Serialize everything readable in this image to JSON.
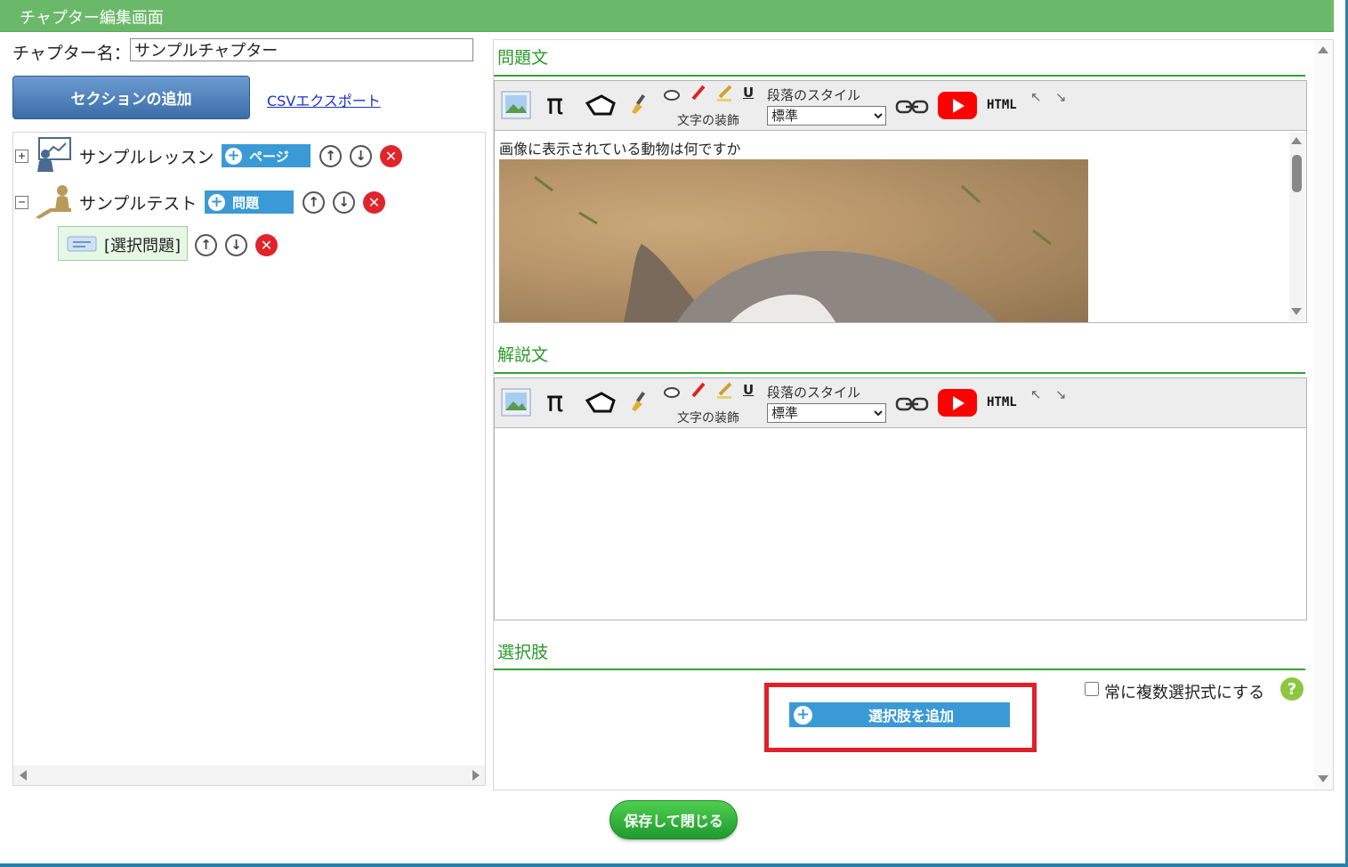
{
  "header": {
    "title": "チャプター編集画面"
  },
  "chapter": {
    "label": "チャプター名：",
    "value": "サンプルチャプター"
  },
  "actions": {
    "add_section": "セクションの追加",
    "csv_export": "CSVエクスポート"
  },
  "tree": {
    "lesson": {
      "label": "サンプルレッスン",
      "add_label": "ページ",
      "expander": "+"
    },
    "test": {
      "label": "サンプルテスト",
      "add_label": "問題",
      "expander": "−"
    },
    "question": {
      "label": "[選択問題]"
    }
  },
  "editor": {
    "question_title": "問題文",
    "explanation_title": "解説文",
    "choices_title": "選択肢",
    "toolbar": {
      "text_decoration": "文字の装飾",
      "paragraph_style": "段落のスタイル",
      "style_value": "標準",
      "html_label": "HTML",
      "underline": "U",
      "pi": "π"
    },
    "question_text": "画像に表示されている動物は何ですか"
  },
  "choices": {
    "add_choice": "選択肢を追加",
    "multi_select_label": "常に複数選択式にする",
    "help": "?"
  },
  "footer": {
    "save_close": "保存して閉じる"
  },
  "colors": {
    "header": "#6ab96a",
    "accent_blue": "#3a9ad6",
    "section_green": "#2a9a2a",
    "highlight_red": "#e0202a",
    "save_green": "#1f9a2f"
  }
}
